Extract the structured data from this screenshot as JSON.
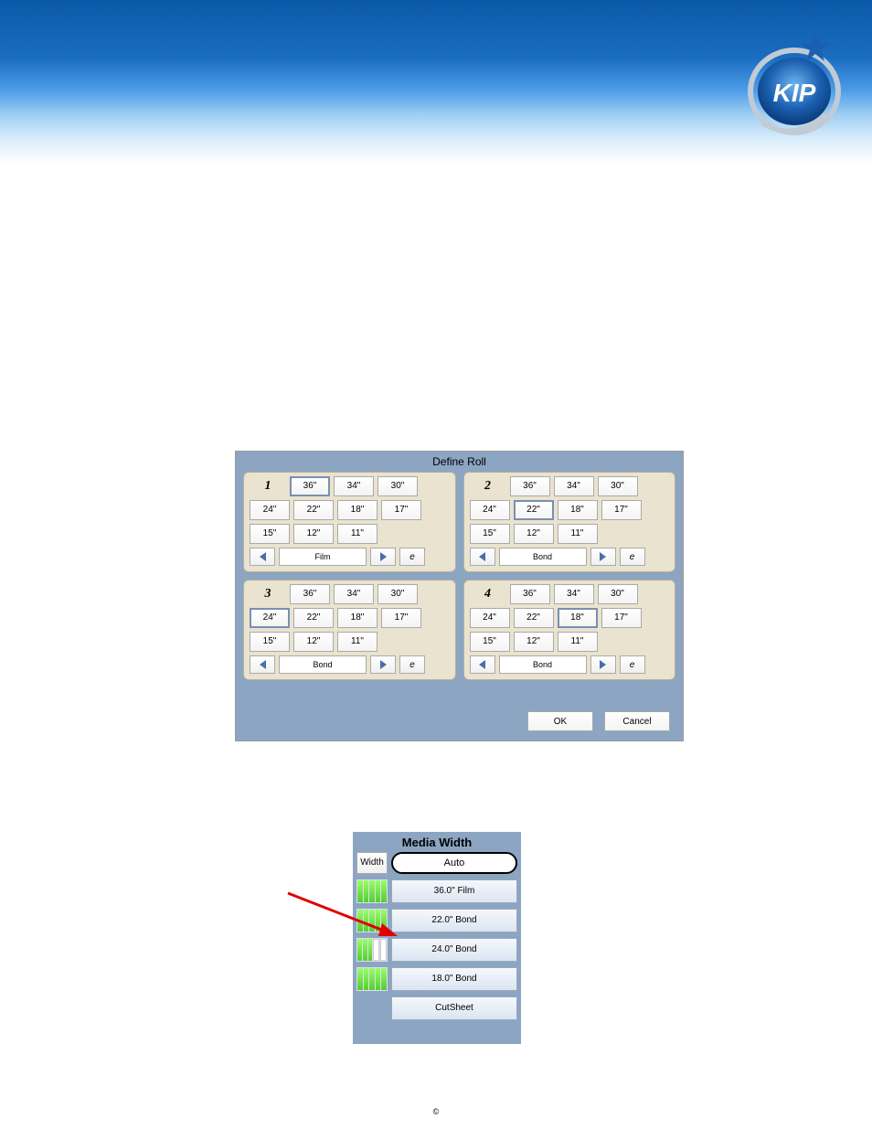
{
  "logo": {
    "text": "KIP"
  },
  "dialog": {
    "title": "Define Roll",
    "ok": "OK",
    "cancel": "Cancel",
    "quads": [
      {
        "num": "1",
        "sizes": [
          "36\"",
          "34\"",
          "30\"",
          "24\"",
          "22\"",
          "18\"",
          "17\"",
          "15\"",
          "12\"",
          "11\""
        ],
        "selected": "36\"",
        "media": "Film"
      },
      {
        "num": "2",
        "sizes": [
          "36\"",
          "34\"",
          "30\"",
          "24\"",
          "22\"",
          "18\"",
          "17\"",
          "15\"",
          "12\"",
          "11\""
        ],
        "selected": "22\"",
        "media": "Bond"
      },
      {
        "num": "3",
        "sizes": [
          "36\"",
          "34\"",
          "30\"",
          "24\"",
          "22\"",
          "18\"",
          "17\"",
          "15\"",
          "12\"",
          "11\""
        ],
        "selected": "24\"",
        "media": "Bond"
      },
      {
        "num": "4",
        "sizes": [
          "36\"",
          "34\"",
          "30\"",
          "24\"",
          "22\"",
          "18\"",
          "17\"",
          "15\"",
          "12\"",
          "11\""
        ],
        "selected": "18\"",
        "media": "Bond"
      }
    ],
    "edit_glyph": "e"
  },
  "media_panel": {
    "title": "Media Width",
    "width_label": "Width",
    "auto": "Auto",
    "rows": [
      {
        "label": "36.0\" Film",
        "fill": 5
      },
      {
        "label": "22.0\" Bond",
        "fill": 5
      },
      {
        "label": "24.0\" Bond",
        "fill": 3
      },
      {
        "label": "18.0\" Bond",
        "fill": 5
      }
    ],
    "cutsheet": "CutSheet"
  },
  "footer": {
    "copyright": "©"
  }
}
